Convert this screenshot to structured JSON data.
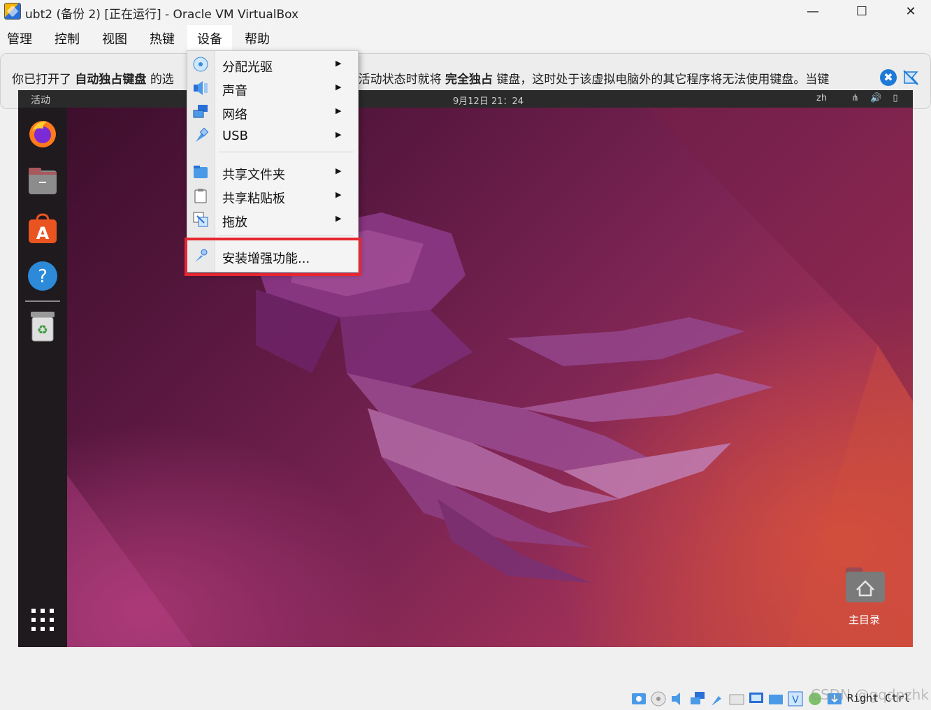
{
  "window": {
    "title": "ubt2 (备份 2) [正在运行] - Oracle VM VirtualBox",
    "min_glyph": "—",
    "max_glyph": "☐",
    "close_glyph": "✕"
  },
  "menubar": {
    "items": [
      "管理",
      "控制",
      "视图",
      "热键",
      "设备",
      "帮助"
    ],
    "active": "设备"
  },
  "banner": {
    "text_1": "你已打开了",
    "bold_1": "自动独占键盘",
    "text_2": "的选",
    "text_3": "于活动状态时就将",
    "bold_2": "完全独占",
    "text_4": "键盘，这时处于该虚拟电脑外的其它程序将无法使用键盘。当键",
    "close_glyph": "✖"
  },
  "guest_topbar": {
    "activities": "活动",
    "clock": "9月12日  21：24",
    "lang": "zh",
    "sys_icons": "⋔ 🔊 ▯"
  },
  "desktop": {
    "home_label": "主目录",
    "dock_icons": [
      "firefox-icon",
      "files-icon",
      "app-center-icon",
      "help-icon",
      "trash-icon",
      "app-grid-icon"
    ]
  },
  "devices_menu": {
    "items": [
      {
        "label": "分配光驱",
        "icon": "optical-drive-icon",
        "submenu": true
      },
      {
        "label": "声音",
        "icon": "audio-icon",
        "submenu": true
      },
      {
        "label": "网络",
        "icon": "network-icon",
        "submenu": true
      },
      {
        "label": "USB",
        "icon": "usb-icon",
        "submenu": true
      },
      {
        "label": "共享文件夹",
        "icon": "shared-folder-icon",
        "submenu": true
      },
      {
        "label": "共享粘贴板",
        "icon": "clipboard-icon",
        "submenu": true
      },
      {
        "label": "拖放",
        "icon": "drag-drop-icon",
        "submenu": true
      },
      {
        "label": "安装增强功能...",
        "icon": "guest-additions-icon",
        "submenu": false
      }
    ],
    "arrow_glyph": "▶",
    "highlight_color": "#e8262f"
  },
  "statusbar": {
    "host_key": "Right Ctrl",
    "watermark": "CSDN @gqdpzhk"
  },
  "colors": {
    "accent_blue": "#1e7ad6",
    "dock_bg": "#1f1a1e"
  }
}
